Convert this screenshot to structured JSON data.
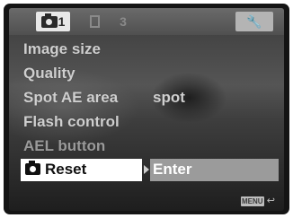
{
  "menu": {
    "items": [
      {
        "label": "Image size",
        "value": ""
      },
      {
        "label": "Quality",
        "value": ""
      },
      {
        "label": "Spot AE area",
        "value": "spot"
      },
      {
        "label": "Flash control",
        "value": ""
      },
      {
        "label": "AEL button",
        "value": ""
      }
    ],
    "selected": {
      "label": "Reset",
      "value": "Enter"
    }
  },
  "tabs": {
    "camera1_number": "1",
    "setup_glyph": "3",
    "wrench_glyph": "🔧"
  },
  "hint": {
    "button_label": "MENU",
    "back_glyph": "↩"
  },
  "icons": [
    "camera-icon",
    "playback-icon",
    "setup-icon",
    "wrench-icon",
    "arrow-right-icon",
    "return-icon"
  ]
}
